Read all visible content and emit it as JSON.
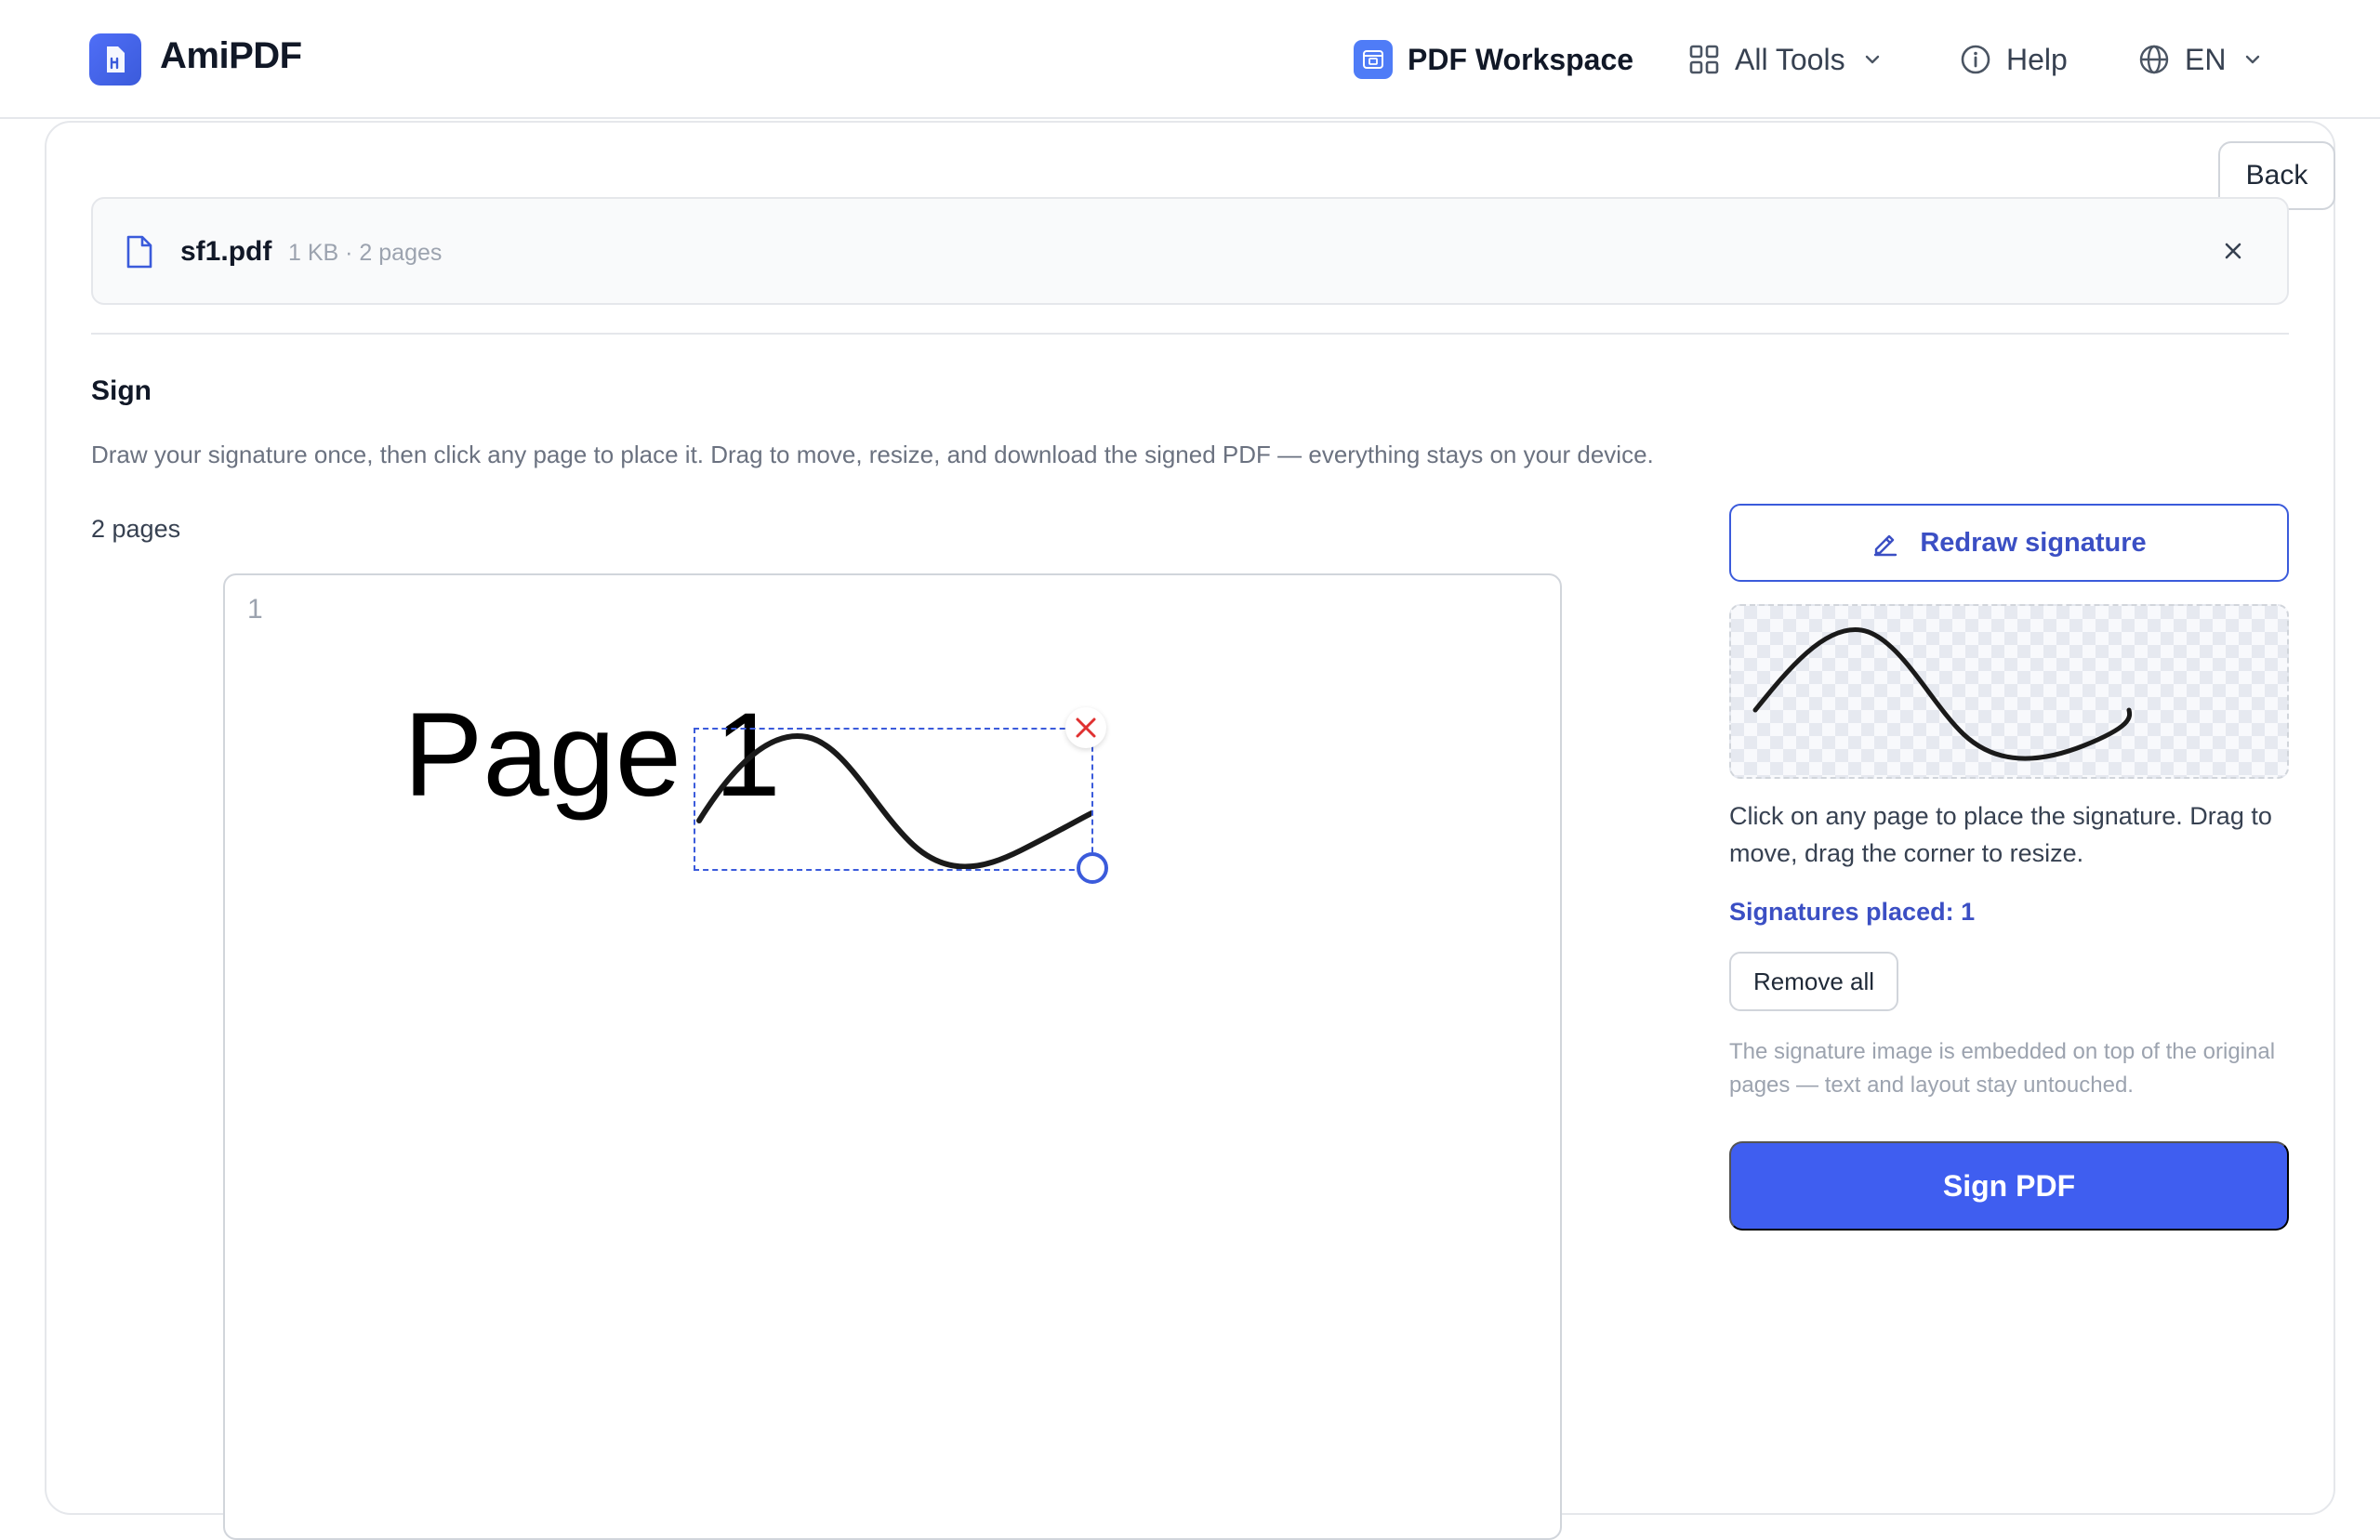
{
  "header": {
    "brand": "AmiPDF",
    "nav": {
      "workspace": "PDF Workspace",
      "all_tools": "All Tools",
      "help": "Help",
      "language": "EN"
    }
  },
  "toolbar": {
    "back_label": "Back"
  },
  "file": {
    "name": "sf1.pdf",
    "meta": "1 KB · 2 pages"
  },
  "section": {
    "title": "Sign",
    "description": "Draw your signature once, then click any page to place it. Drag to move, resize, and download the signed PDF — everything stays on your device.",
    "pages_count": "2 pages"
  },
  "preview": {
    "page_number": "1",
    "page_text": "Page 1"
  },
  "panel": {
    "redraw_label": "Redraw signature",
    "hint": "Click on any page to place the signature. Drag to move, drag the corner to resize.",
    "placed_label": "Signatures placed: 1",
    "remove_all_label": "Remove all",
    "note": "The signature image is embedded on top of the original pages — text and layout stay untouched.",
    "sign_label": "Sign PDF"
  },
  "colors": {
    "accent": "#3f5ef0",
    "accent_text": "#3b4fc4",
    "remove_icon": "#e03131"
  },
  "icons": {
    "logo": "pdf-logo-icon",
    "workspace": "workspace-icon",
    "all_tools": "grid-icon",
    "help": "info-icon",
    "language": "globe-icon",
    "file": "file-icon",
    "close": "close-icon",
    "redraw": "pen-icon",
    "signature_remove": "close-icon",
    "signature_resize": "resize-handle-icon"
  }
}
